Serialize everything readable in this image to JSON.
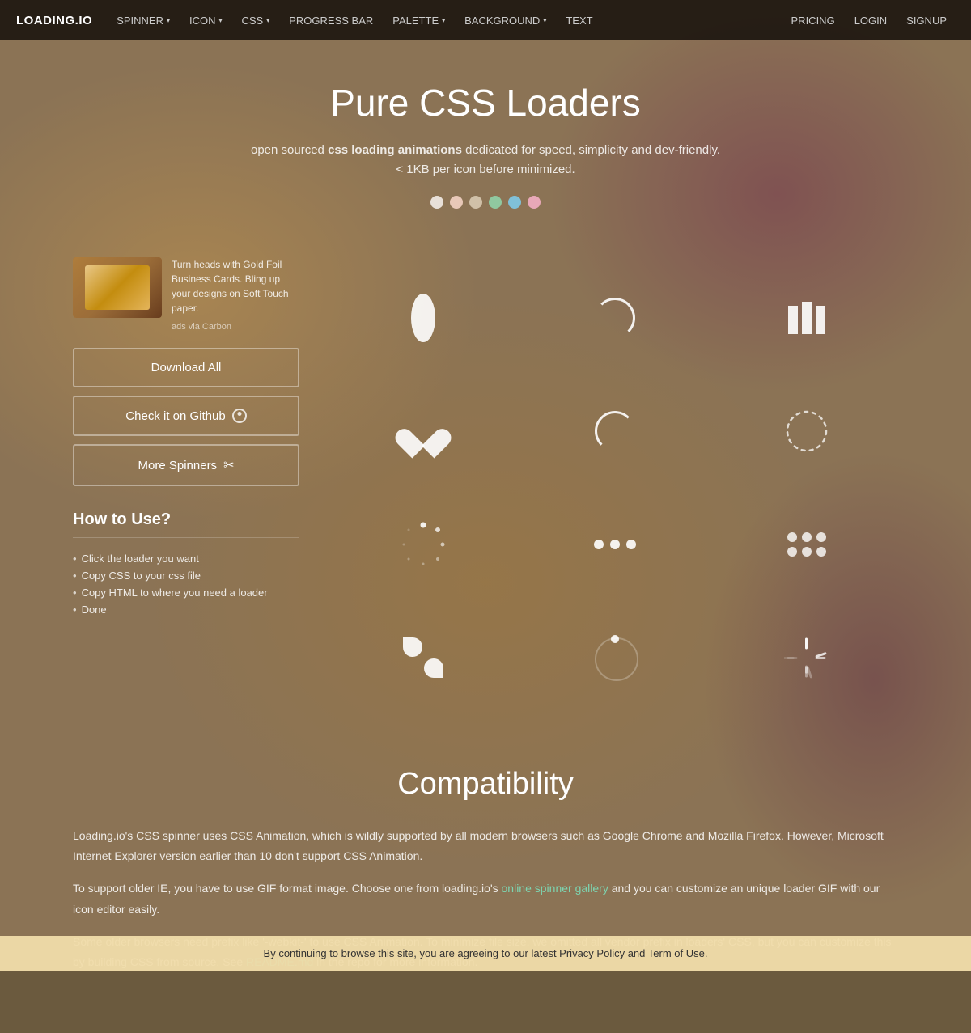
{
  "nav": {
    "logo": "LOADING.IO",
    "items_left": [
      {
        "label": "SPINNER",
        "has_arrow": true
      },
      {
        "label": "ICON",
        "has_arrow": true
      },
      {
        "label": "CSS",
        "has_arrow": true
      },
      {
        "label": "PROGRESS BAR",
        "has_arrow": false
      },
      {
        "label": "PALETTE",
        "has_arrow": true
      },
      {
        "label": "BACKGROUND",
        "has_arrow": true
      },
      {
        "label": "TEXT",
        "has_arrow": false
      }
    ],
    "items_right": [
      {
        "label": "PRICING"
      },
      {
        "label": "LOGIN"
      },
      {
        "label": "SIGNUP"
      }
    ]
  },
  "hero": {
    "title": "Pure CSS Loaders",
    "description_plain": "open sourced ",
    "description_bold": "css loading animations",
    "description_rest": " dedicated for speed, simplicity and dev-friendly.",
    "description2": "< 1KB per icon before minimized.",
    "color_dots": [
      {
        "color": "#e8e0d8"
      },
      {
        "color": "#e8c8b8"
      },
      {
        "color": "#d0c0a8"
      },
      {
        "color": "#90c8a0"
      },
      {
        "color": "#80c0d8"
      },
      {
        "color": "#e8a8b8"
      }
    ]
  },
  "ad": {
    "text": "Turn heads with Gold Foil Business Cards. Bling up your designs on Soft Touch paper.",
    "via": "ads via Carbon"
  },
  "buttons": {
    "download_all": "Download All",
    "check_github": "Check it on Github",
    "more_spinners": "More Spinners"
  },
  "how_to_use": {
    "title": "How to Use?",
    "steps": [
      "Click the loader you want",
      "Copy CSS to your css file",
      "Copy HTML to where you need a loader",
      "Done"
    ]
  },
  "compatibility": {
    "title": "Compatibility",
    "paragraphs": [
      "Loading.io's CSS spinner uses CSS Animation, which is wildly supported by all modern browsers such as Google Chrome and Mozilla Firefox. However, Microsoft Internet Explorer version earlier than 10 don't support CSS Animation.",
      "To support older IE, you have to use GIF format image. Choose one from loading.io's {{online spinner gallery}} and you can customize an unique loader GIF with our icon editor easily.",
      "Some older browsers need prefix like '-webkit-' to use CSS Animation. To minimize file size, we omitted all vendor prefix in loaders' CSS, but you can customize this by building CSS from source. See {{README.md}} in the repo for more information."
    ],
    "link1_text": "online spinner gallery",
    "link2_text": "README.md"
  },
  "cookie": {
    "text": "By continuing to browse this site, you are agreeing to our latest Privacy Policy and Term of Use."
  }
}
